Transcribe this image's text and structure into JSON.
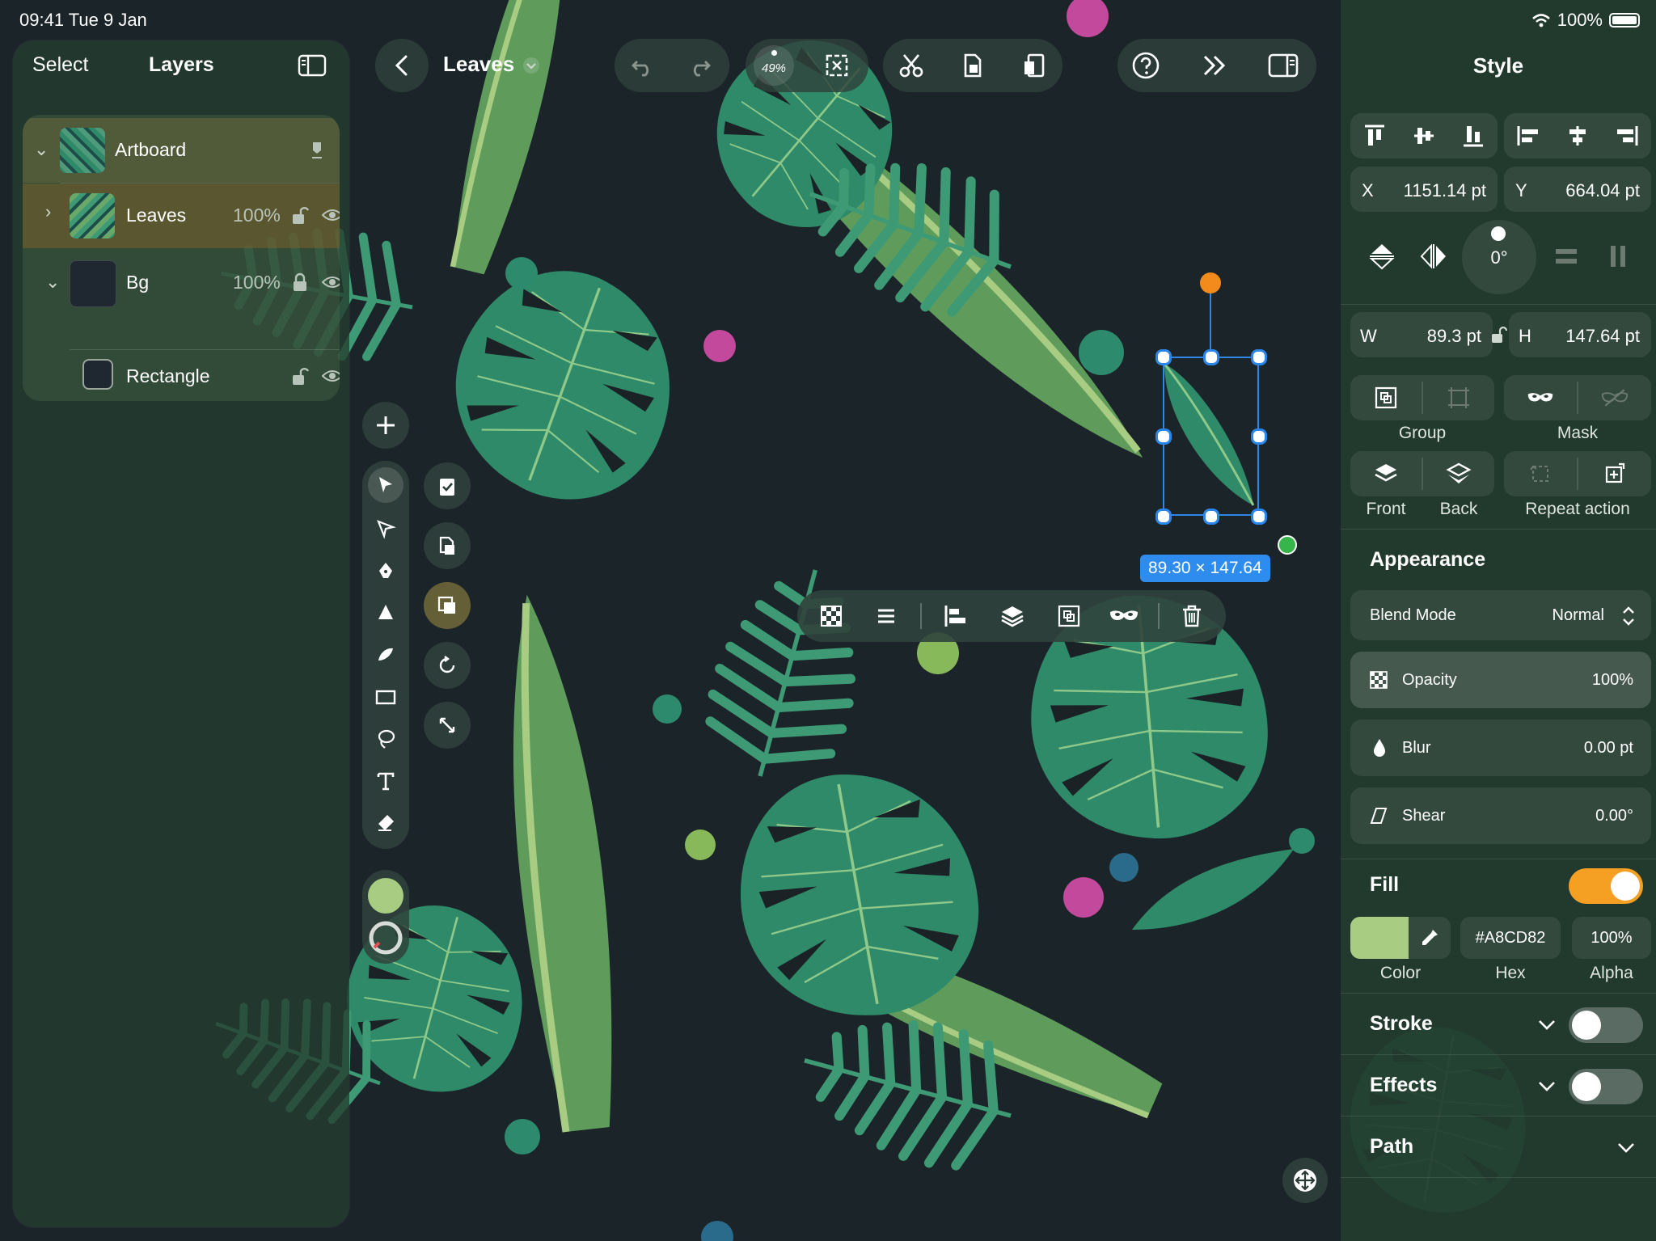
{
  "status": {
    "time": "09:41  Tue 9 Jan",
    "battery": "100%"
  },
  "layers_panel": {
    "select_label": "Select",
    "title": "Layers",
    "items": [
      {
        "name": "Artboard"
      },
      {
        "name": "Leaves",
        "opacity": "100%"
      },
      {
        "name": "Bg",
        "opacity": "100%"
      },
      {
        "name": "Rectangle"
      }
    ]
  },
  "toolbar": {
    "document": "Leaves",
    "zoom": "49%"
  },
  "selection": {
    "size": "89.30 × 147.64"
  },
  "colors": {
    "fill": "#A8CD82",
    "accent": "#2D8CEE",
    "toggle_on": "#F5A023"
  },
  "style_panel": {
    "title": "Style",
    "x_label": "X",
    "x_value": "1151.14 pt",
    "y_label": "Y",
    "y_value": "664.04 pt",
    "rotation": "0°",
    "w_label": "W",
    "w_value": "89.3 pt",
    "h_label": "H",
    "h_value": "147.64 pt",
    "group_label": "Group",
    "mask_label": "Mask",
    "front_label": "Front",
    "back_label": "Back",
    "repeat_label": "Repeat action",
    "appearance": {
      "title": "Appearance",
      "blend_label": "Blend Mode",
      "blend_value": "Normal",
      "opacity_label": "Opacity",
      "opacity_value": "100%",
      "blur_label": "Blur",
      "blur_value": "0.00 pt",
      "shear_label": "Shear",
      "shear_value": "0.00°"
    },
    "fill": {
      "title": "Fill",
      "hex": "#A8CD82",
      "alpha": "100%",
      "color_caption": "Color",
      "hex_caption": "Hex",
      "alpha_caption": "Alpha"
    },
    "stroke_title": "Stroke",
    "effects_title": "Effects",
    "path_title": "Path"
  }
}
